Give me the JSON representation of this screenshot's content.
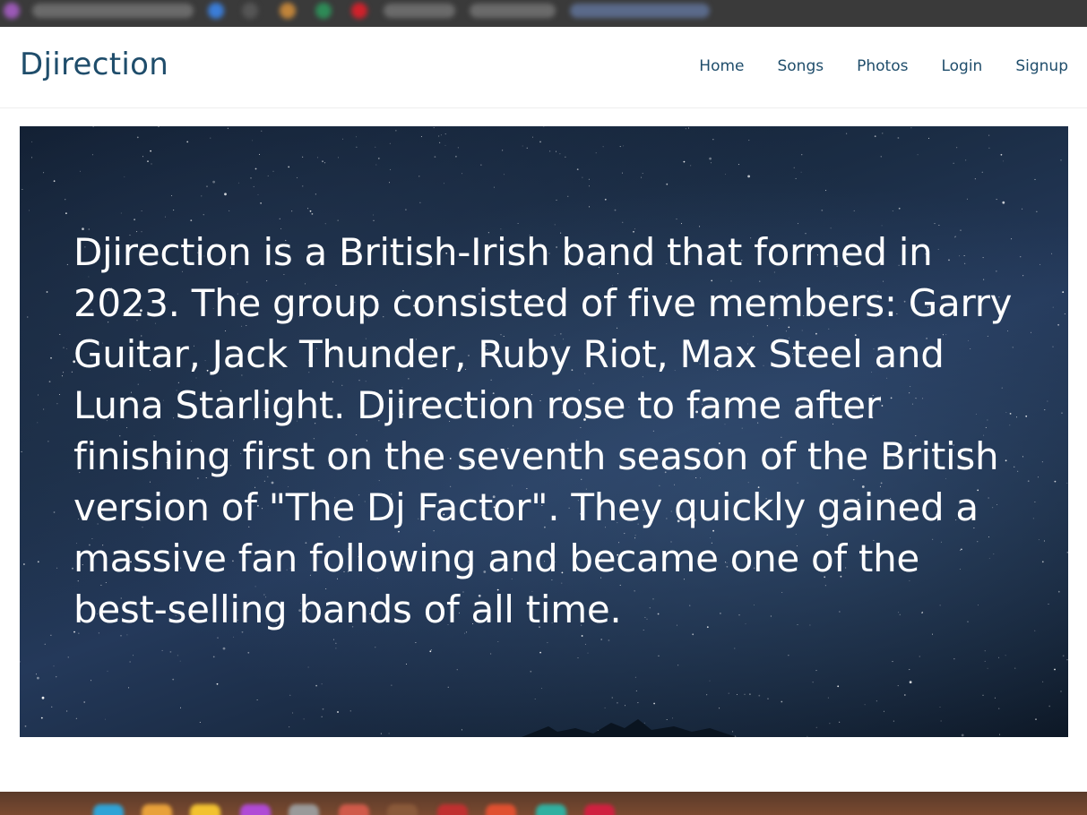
{
  "navbar": {
    "brand": "Djirection",
    "links": [
      {
        "label": "Home"
      },
      {
        "label": "Songs"
      },
      {
        "label": "Photos"
      },
      {
        "label": "Login"
      },
      {
        "label": "Signup"
      }
    ]
  },
  "hero": {
    "text": "Djirection is a British-Irish band that formed in 2023. The group consisted of five members: Garry Guitar, Jack Thunder, Ruby Riot, Max Steel and Luna Starlight. Djirection rose to fame after finishing first on the seventh season of the British version of \"The Dj Factor\". They quickly gained a massive fan following and became one of the best-selling bands of all time."
  },
  "colors": {
    "brand": "#1f4d6b",
    "hero_text": "#ffffff",
    "hero_background": "#1b2d45"
  }
}
